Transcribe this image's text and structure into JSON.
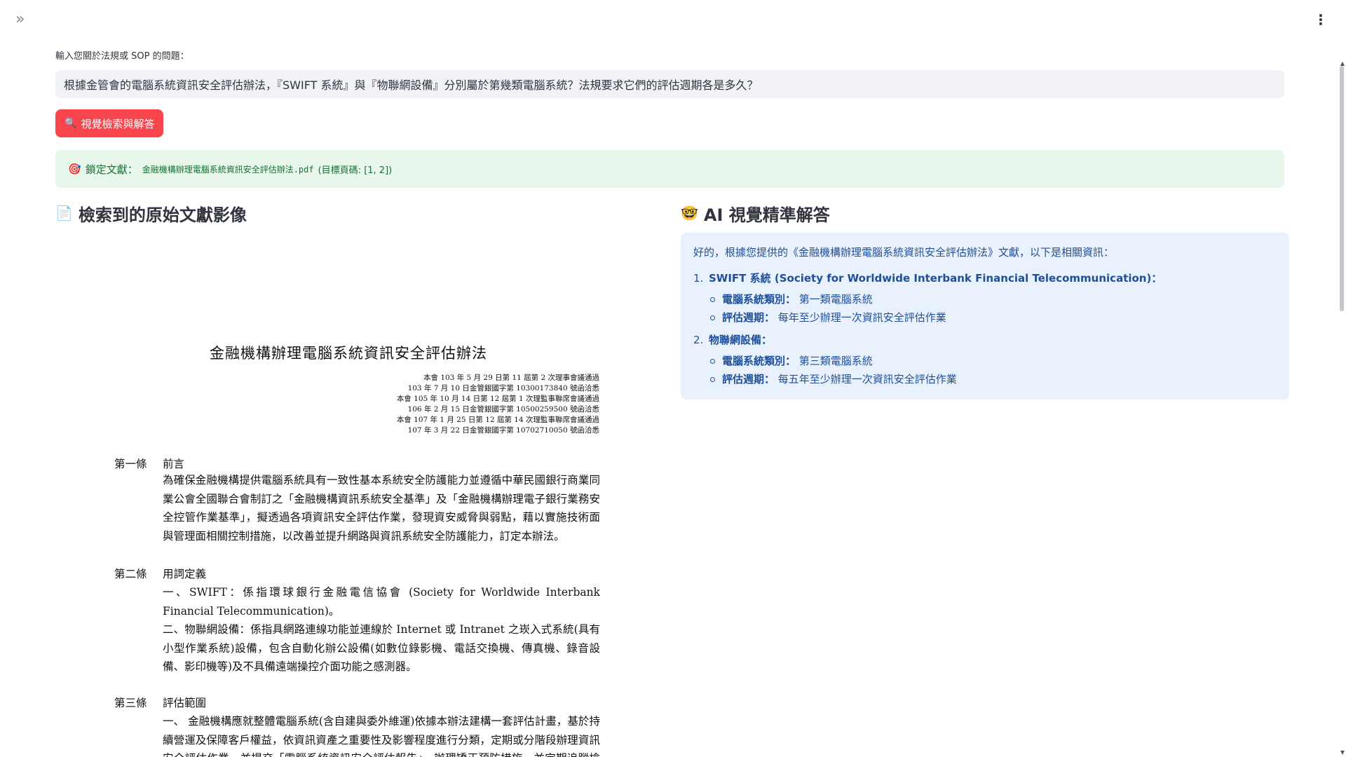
{
  "chrome": {
    "sidebar_toggle_glyph": "»",
    "menu_glyph": "⋮"
  },
  "query": {
    "label": "輸入您關於法規或 SOP 的問題：",
    "value": "根據金管會的電腦系統資訊安全評估辦法，『SWIFT 系統』與『物聯網設備』分別屬於第幾類電腦系統？法規要求它們的評估週期各是多久？"
  },
  "search_button": {
    "icon": "🔍",
    "label": "視覺檢索與解答"
  },
  "status": {
    "icon": "🎯",
    "prefix": "鎖定文獻：",
    "doc_name": "金融機構辦理電腦系統資訊安全評估辦法.pdf",
    "pages": "(目標頁碼: [1, 2])"
  },
  "left_panel": {
    "icon": "📄",
    "title": "檢索到的原始文獻影像"
  },
  "document": {
    "title": "金融機構辦理電腦系統資訊安全評估辦法",
    "history": [
      "本會 103 年 5 月 29 日第 11 屆第 2 次理事會議通過",
      "103 年 7 月 10 日金管銀國字第 10300173840 號函洽悉",
      "本會 105 年 10 月 14 日第 12 屆第 1 次理監事聯席會議通過",
      "106 年 2 月 15 日金管銀國字第 10500259500 號函洽悉",
      "本會 107 年 1 月 25 日第 12 屆第 14 次理監事聯席會議通過",
      "107 年 3 月 22 日金管銀國字第 10702710050 號函洽悉"
    ],
    "art1_num": "第一條",
    "art1_head": "前言",
    "art1_body": "為確保金融機構提供電腦系統具有一致性基本系統安全防護能力並遵循中華民國銀行商業同業公會全國聯合會制訂之「金融機構資訊系統安全基準」及「金融機構辦理電子銀行業務安全控管作業基準」，擬透過各項資訊安全評估作業，發現資安威脅與弱點，藉以實施技術面與管理面相關控制措施，以改善並提升網路與資訊系統安全防護能力，訂定本辦法。",
    "art2_num": "第二條",
    "art2_head": "用詞定義",
    "art2_item1": "一、SWIFT：係指環球銀行金融電信協會 (Society for Worldwide Interbank Financial Telecommunication)。",
    "art2_item2": "二、物聯網設備：係指具網路連線功能並連線於 Internet 或 Intranet 之崁入式系統(具有小型作業系統)設備，包含自動化辦公設備(如數位錄影機、電話交換機、傳真機、錄音設備、影印機等)及不具備遠端操控介面功能之感測器。",
    "art3_num": "第三條",
    "art3_head": "評估範圍",
    "art3_item1": "一、 金融機構應就整體電腦系統(含自建與委外維運)依據本辦法建構一套評估計畫，基於持續營運及保障客戶權益，依資訊資產之重要性及影響程度進行分類，定期或分階段辦理資訊安全評估作業，並提交「電腦系統資訊安全評估報告」，辦理矯正預防措施，並定期追蹤檢討。"
  },
  "right_panel": {
    "icon": "🤓",
    "title": "AI 視覺精準解答"
  },
  "answer": {
    "intro": "好的，根據您提供的《金融機構辦理電腦系統資訊安全評估辦法》文獻，以下是相關資訊：",
    "items": [
      {
        "num": "1.",
        "title": "SWIFT 系統 (Society for Worldwide Interbank Financial Telecommunication)：",
        "subs": [
          {
            "key": "電腦系統類別：",
            "val": "第一類電腦系統"
          },
          {
            "key": "評估週期：",
            "val": "每年至少辦理一次資訊安全評估作業"
          }
        ]
      },
      {
        "num": "2.",
        "title": "物聯網設備：",
        "subs": [
          {
            "key": "電腦系統類別：",
            "val": "第三類電腦系統"
          },
          {
            "key": "評估週期：",
            "val": "每五年至少辦理一次資訊安全評估作業"
          }
        ]
      }
    ]
  },
  "colors": {
    "primary_button": "#f7454d",
    "success_bg": "#e8f6ec",
    "success_text": "#177233",
    "info_bg": "#e8f1fc",
    "info_text": "#1e4f9a"
  }
}
